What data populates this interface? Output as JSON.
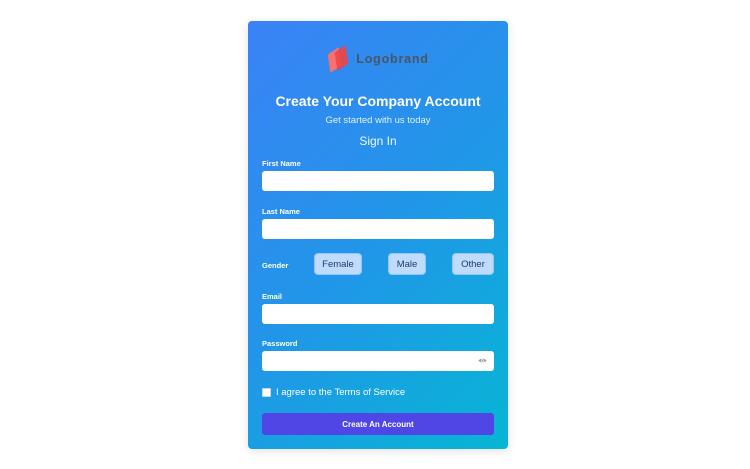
{
  "brand": {
    "logo_icon": "logo-mark",
    "name": "Logobrand"
  },
  "header": {
    "title": "Create Your Company Account",
    "subtitle": "Get started with us today",
    "signin_link": "Sign In"
  },
  "form": {
    "first_name": {
      "label": "First Name",
      "value": ""
    },
    "last_name": {
      "label": "Last Name",
      "value": ""
    },
    "gender": {
      "label": "Gender",
      "options": [
        "Female",
        "Male",
        "Other"
      ]
    },
    "email": {
      "label": "Email",
      "value": ""
    },
    "password": {
      "label": "Password",
      "value": "",
      "toggle_icon": "eye-icon"
    },
    "terms": {
      "label": "I agree to the Terms of Service",
      "checked": false
    },
    "submit_label": "Create An Account"
  },
  "colors": {
    "card_gradient_start": "#3b82f6",
    "card_gradient_end": "#06b6d4",
    "submit_button": "#4f46e5",
    "gender_button": "#bfdbfe",
    "logo_accent": "#ef4444"
  }
}
